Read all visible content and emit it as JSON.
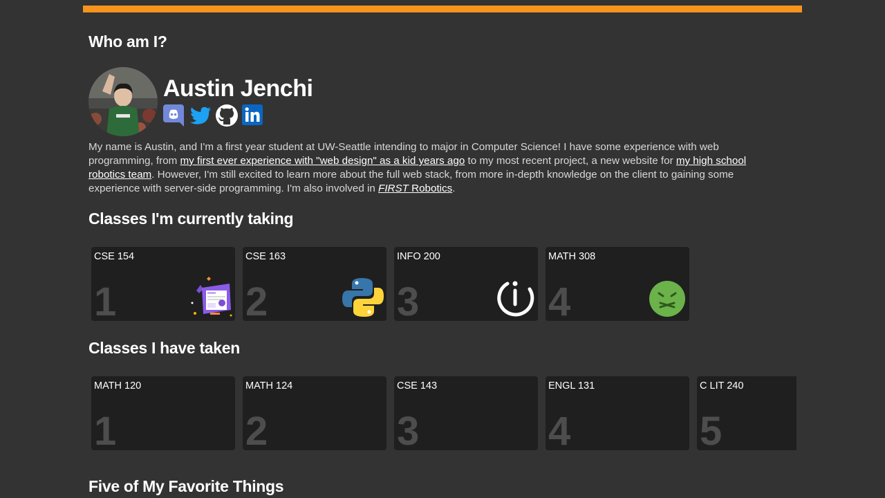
{
  "colors": {
    "accent": "#f7941d",
    "background": "#333333",
    "card": "#1f1f1f",
    "card_number": "#4d4d4d",
    "discord": "#7289da",
    "twitter": "#1da1f2",
    "linkedin": "#0a66c2"
  },
  "headings": {
    "who": "Who am I?",
    "current": "Classes I'm currently taking",
    "taken": "Classes I have taken",
    "favorites": "Five of My Favorite Things"
  },
  "profile": {
    "name": "Austin Jenchi",
    "socials": [
      "discord-icon",
      "twitter-icon",
      "github-icon",
      "linkedin-icon"
    ]
  },
  "bio": {
    "p1": "My name is Austin, and I'm a first year student at UW-Seattle intending to major in Computer Science! I have some experience with web programming, from ",
    "link1": "my first ever experience with \"web design\" as a kid years ago",
    "p2": " to my most recent project, a new website for ",
    "link2": "my high school robotics team",
    "p3": ". However, I'm still excited to learn more about the full web stack, from more in-depth knowledge on the client to gaining some experience with server-side programming. I'm also involved in ",
    "link3_em": "FIRST",
    "link3_rest": " Robotics",
    "p4": "."
  },
  "current_classes": [
    {
      "code": "CSE 154",
      "num": "1",
      "icon": "web-design-illustration-icon"
    },
    {
      "code": "CSE 163",
      "num": "2",
      "icon": "python-logo-icon"
    },
    {
      "code": "INFO 200",
      "num": "3",
      "icon": "power-i-logo-icon"
    },
    {
      "code": "MATH 308",
      "num": "4",
      "icon": "nauseated-face-icon"
    }
  ],
  "taken_classes": [
    {
      "code": "MATH 120",
      "num": "1"
    },
    {
      "code": "MATH 124",
      "num": "2"
    },
    {
      "code": "CSE 143",
      "num": "3"
    },
    {
      "code": "ENGL 131",
      "num": "4"
    },
    {
      "code": "C LIT 240",
      "num": "5"
    }
  ]
}
